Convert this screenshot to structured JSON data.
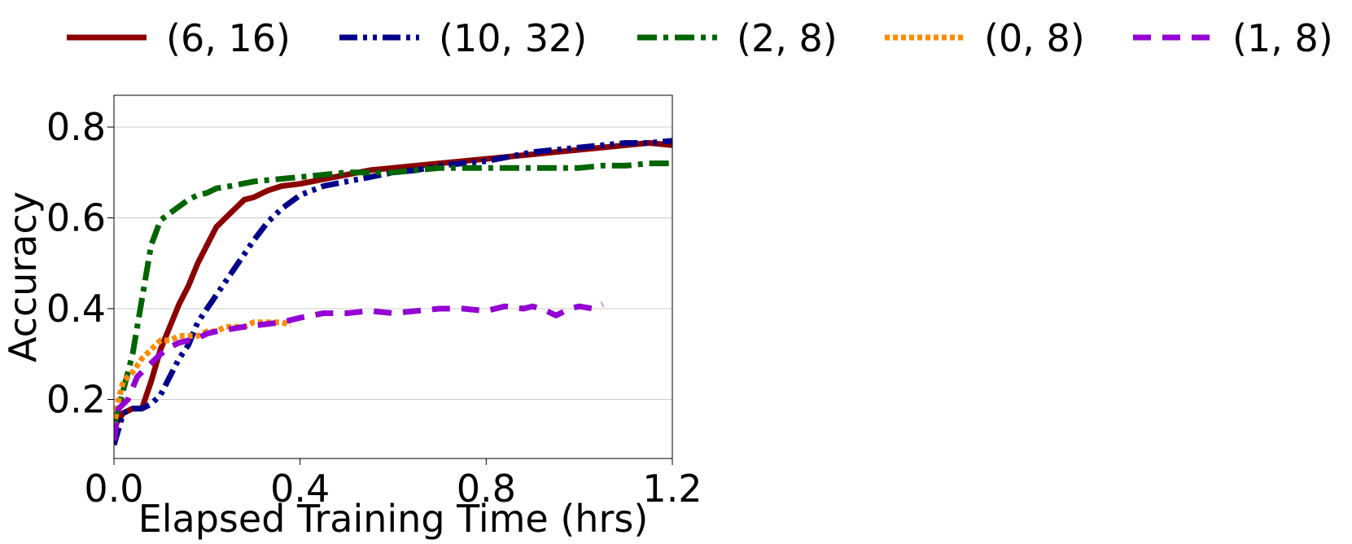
{
  "chart_data": {
    "type": "line",
    "title": "",
    "xlabel": "Elapsed Training Time (hrs)",
    "ylabel": "Accuracy",
    "xlim": [
      0.0,
      1.2
    ],
    "ylim": [
      0.07,
      0.87
    ],
    "xticks": [
      0.0,
      0.4,
      0.8,
      1.2
    ],
    "xtick_labels": [
      "0.0",
      "0.4",
      "0.8",
      "1.2"
    ],
    "yticks": [
      0.2,
      0.4,
      0.6,
      0.8
    ],
    "ytick_labels": [
      "0.2",
      "0.4",
      "0.6",
      "0.8"
    ],
    "grid": "horizontal",
    "legend_placement": "top",
    "series": [
      {
        "name": "(6, 16)",
        "color": "#8b0000",
        "dash": "solid",
        "x": [
          0.0,
          0.02,
          0.04,
          0.06,
          0.08,
          0.1,
          0.12,
          0.14,
          0.16,
          0.18,
          0.2,
          0.22,
          0.24,
          0.26,
          0.28,
          0.3,
          0.33,
          0.36,
          0.4,
          0.45,
          0.5,
          0.55,
          0.6,
          0.65,
          0.7,
          0.75,
          0.8,
          0.85,
          0.9,
          0.95,
          1.0,
          1.05,
          1.1,
          1.15,
          1.2
        ],
        "y": [
          0.14,
          0.17,
          0.18,
          0.18,
          0.24,
          0.31,
          0.36,
          0.41,
          0.45,
          0.5,
          0.54,
          0.58,
          0.6,
          0.62,
          0.64,
          0.645,
          0.66,
          0.67,
          0.675,
          0.685,
          0.695,
          0.705,
          0.71,
          0.715,
          0.72,
          0.725,
          0.73,
          0.735,
          0.74,
          0.745,
          0.75,
          0.755,
          0.76,
          0.765,
          0.76
        ]
      },
      {
        "name": "(10, 32)",
        "color": "#00008b",
        "dash": "dashdotdot",
        "x": [
          0.0,
          0.02,
          0.04,
          0.06,
          0.08,
          0.1,
          0.12,
          0.14,
          0.16,
          0.18,
          0.2,
          0.22,
          0.24,
          0.26,
          0.28,
          0.3,
          0.33,
          0.36,
          0.4,
          0.45,
          0.5,
          0.55,
          0.6,
          0.65,
          0.7,
          0.75,
          0.8,
          0.85,
          0.9,
          0.95,
          1.0,
          1.05,
          1.1,
          1.15,
          1.2
        ],
        "y": [
          0.1,
          0.17,
          0.18,
          0.18,
          0.19,
          0.21,
          0.25,
          0.29,
          0.32,
          0.37,
          0.4,
          0.43,
          0.46,
          0.49,
          0.52,
          0.55,
          0.59,
          0.62,
          0.65,
          0.67,
          0.68,
          0.69,
          0.7,
          0.705,
          0.715,
          0.72,
          0.725,
          0.735,
          0.745,
          0.75,
          0.755,
          0.76,
          0.765,
          0.765,
          0.77
        ]
      },
      {
        "name": "(2, 8)",
        "color": "#006400",
        "dash": "dashdot",
        "x": [
          0.0,
          0.02,
          0.04,
          0.06,
          0.08,
          0.1,
          0.12,
          0.14,
          0.16,
          0.18,
          0.2,
          0.22,
          0.25,
          0.3,
          0.35,
          0.4,
          0.45,
          0.5,
          0.55,
          0.6,
          0.65,
          0.7,
          0.75,
          0.8,
          0.85,
          0.9,
          0.95,
          1.0,
          1.05,
          1.1,
          1.15,
          1.2
        ],
        "y": [
          0.14,
          0.22,
          0.3,
          0.42,
          0.54,
          0.595,
          0.61,
          0.625,
          0.64,
          0.65,
          0.655,
          0.665,
          0.67,
          0.68,
          0.685,
          0.69,
          0.695,
          0.7,
          0.7,
          0.7,
          0.705,
          0.71,
          0.71,
          0.71,
          0.71,
          0.71,
          0.71,
          0.71,
          0.715,
          0.715,
          0.72,
          0.72
        ]
      },
      {
        "name": "(0, 8)",
        "color": "#ff8c00",
        "dash": "dotted",
        "x": [
          0.0,
          0.01,
          0.02,
          0.04,
          0.06,
          0.08,
          0.1,
          0.12,
          0.14,
          0.16,
          0.18,
          0.2,
          0.22,
          0.24,
          0.26,
          0.28,
          0.3,
          0.32,
          0.34,
          0.36,
          0.38
        ],
        "y": [
          0.14,
          0.2,
          0.24,
          0.26,
          0.29,
          0.31,
          0.33,
          0.33,
          0.34,
          0.34,
          0.34,
          0.35,
          0.35,
          0.36,
          0.36,
          0.36,
          0.37,
          0.37,
          0.37,
          0.37,
          0.365
        ]
      },
      {
        "name": "(1, 8)",
        "color": "#9400d3",
        "dash": "dashed",
        "x": [
          0.0,
          0.01,
          0.03,
          0.05,
          0.08,
          0.1,
          0.12,
          0.14,
          0.16,
          0.18,
          0.2,
          0.22,
          0.25,
          0.28,
          0.32,
          0.36,
          0.4,
          0.45,
          0.5,
          0.55,
          0.6,
          0.65,
          0.7,
          0.75,
          0.8,
          0.84,
          0.88,
          0.9,
          0.93,
          0.95,
          0.98,
          1.0,
          1.03,
          1.05
        ],
        "y": [
          0.11,
          0.18,
          0.2,
          0.25,
          0.28,
          0.3,
          0.315,
          0.325,
          0.33,
          0.335,
          0.345,
          0.35,
          0.355,
          0.36,
          0.365,
          0.37,
          0.38,
          0.39,
          0.39,
          0.395,
          0.39,
          0.395,
          0.4,
          0.4,
          0.395,
          0.405,
          0.4,
          0.405,
          0.395,
          0.385,
          0.4,
          0.405,
          0.4,
          0.41
        ]
      }
    ]
  }
}
